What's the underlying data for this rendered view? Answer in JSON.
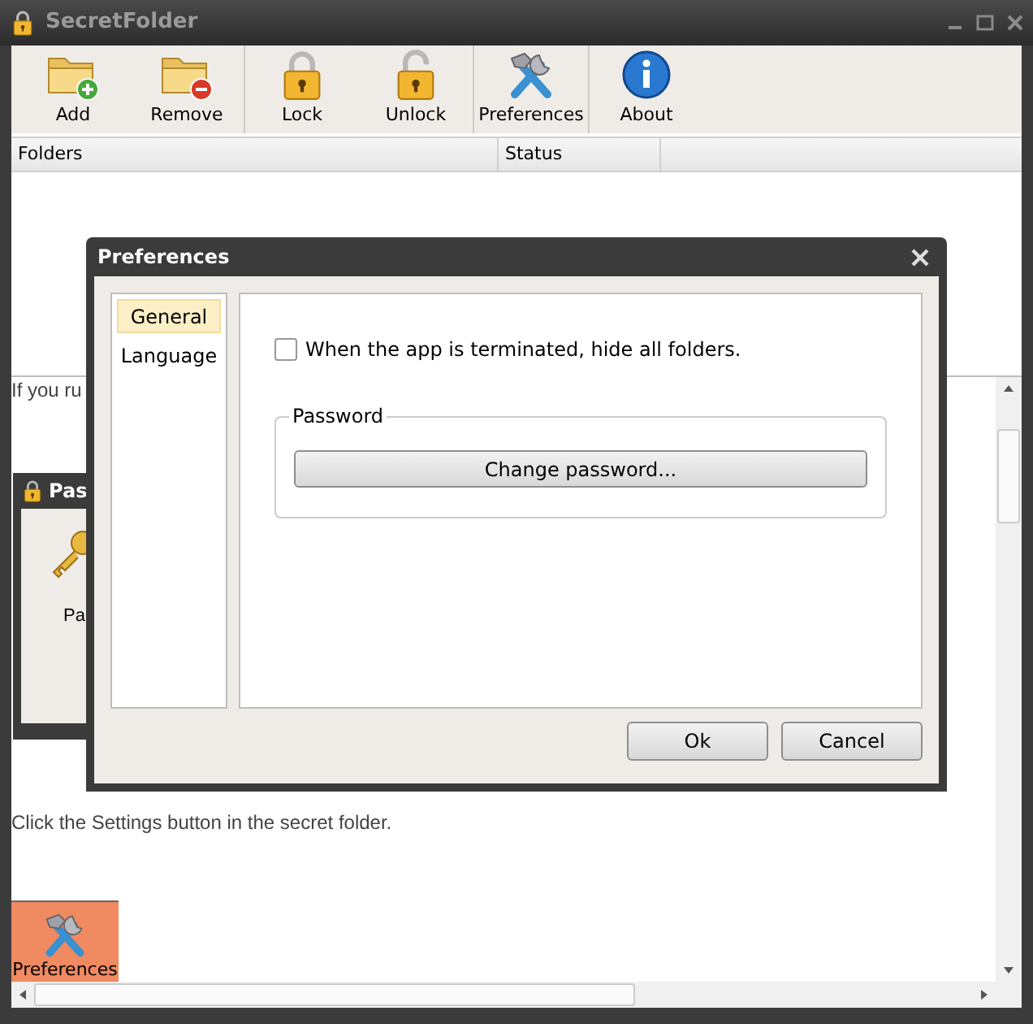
{
  "window": {
    "title": "SecretFolder"
  },
  "toolbar": {
    "groups": [
      [
        {
          "label": "Add",
          "kind": "folder-add"
        },
        {
          "label": "Remove",
          "kind": "folder-remove"
        }
      ],
      [
        {
          "label": "Lock",
          "kind": "lock"
        },
        {
          "label": "Unlock",
          "kind": "unlock"
        }
      ],
      [
        {
          "label": "Preferences",
          "kind": "tools"
        }
      ],
      [
        {
          "label": "About",
          "kind": "info"
        }
      ]
    ]
  },
  "table": {
    "columns": [
      "Folders",
      "Status"
    ]
  },
  "help_page": {
    "intro_text": "If you ru",
    "small_window": {
      "title": "Pas",
      "label": "Pa"
    },
    "instruction": "Click the Settings button in the secret folder.",
    "tile": {
      "label": "Preferences"
    }
  },
  "dialog": {
    "title": "Preferences",
    "nav": [
      {
        "label": "General",
        "selected": true
      },
      {
        "label": "Language",
        "selected": false
      }
    ],
    "hide_option": {
      "label": "When the app is terminated, hide all folders.",
      "checked": false
    },
    "password_group": {
      "title": "Password",
      "button": "Change password..."
    },
    "buttons": [
      "Ok",
      "Cancel"
    ]
  }
}
